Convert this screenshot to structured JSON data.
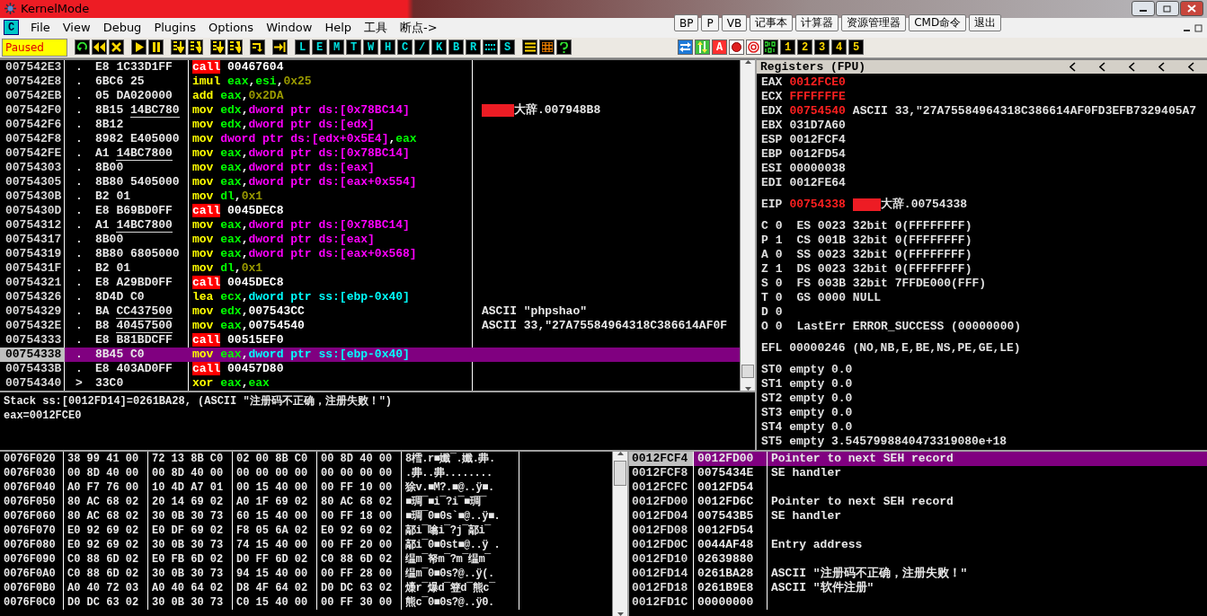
{
  "window": {
    "title": "KernelMode"
  },
  "menu": {
    "child_icon": "C",
    "items": [
      "File",
      "View",
      "Debug",
      "Plugins",
      "Options",
      "Window",
      "Help",
      "工具",
      "断点->"
    ]
  },
  "quick_buttons": [
    "BP",
    "P",
    "VB",
    "记事本",
    "计算器",
    "资源管理器",
    "CMD命令",
    "退出"
  ],
  "toolbar": {
    "status": "Paused",
    "groups": [
      [
        {
          "kind": "restart"
        },
        {
          "kind": "rewind"
        },
        {
          "kind": "close"
        }
      ],
      [
        {
          "kind": "play"
        },
        {
          "kind": "pause"
        }
      ],
      [
        {
          "kind": "step-into"
        },
        {
          "kind": "step-over"
        }
      ],
      [
        {
          "kind": "trace-into"
        },
        {
          "kind": "trace-over"
        }
      ],
      [
        {
          "kind": "return"
        }
      ],
      [
        {
          "kind": "goto"
        }
      ],
      [
        {
          "kind": "letter",
          "text": "L"
        },
        {
          "kind": "letter",
          "text": "E"
        },
        {
          "kind": "letter",
          "text": "M"
        },
        {
          "kind": "letter",
          "text": "T"
        },
        {
          "kind": "letter",
          "text": "W"
        },
        {
          "kind": "letter",
          "text": "H"
        },
        {
          "kind": "letter",
          "text": "C"
        },
        {
          "kind": "letter",
          "text": "/"
        },
        {
          "kind": "letter",
          "text": "K"
        },
        {
          "kind": "letter",
          "text": "B"
        },
        {
          "kind": "letter",
          "text": "R"
        },
        {
          "kind": "dots"
        },
        {
          "kind": "letter",
          "text": "S"
        }
      ],
      [
        {
          "kind": "list"
        },
        {
          "kind": "grid"
        },
        {
          "kind": "help"
        }
      ]
    ],
    "right_group": [
      {
        "kind": "swap"
      },
      {
        "kind": "updown"
      },
      {
        "kind": "badge",
        "text": "A"
      },
      {
        "kind": "record"
      },
      {
        "kind": "target"
      },
      {
        "kind": "binary"
      },
      {
        "kind": "digit",
        "text": "1"
      },
      {
        "kind": "digit",
        "text": "2"
      },
      {
        "kind": "digit",
        "text": "3"
      },
      {
        "kind": "digit",
        "text": "4"
      },
      {
        "kind": "digit",
        "text": "5"
      }
    ]
  },
  "disasm": {
    "rows": [
      {
        "addr": "007542E3",
        "mark": ".",
        "hex": "E8",
        "arg": "1C33D1FF",
        "ul": false,
        "mnemonic": "call",
        "kind": "call",
        "ops": [
          {
            "text": "00467604",
            "kind": "addr"
          }
        ],
        "selected": false
      },
      {
        "addr": "007542E8",
        "mark": ".",
        "hex": "6BC6",
        "arg": "25",
        "ul": false,
        "mnemonic": "imul",
        "kind": "op",
        "ops": [
          {
            "text": "eax",
            "kind": "reg"
          },
          {
            "text": ",",
            "kind": "punct"
          },
          {
            "text": "esi",
            "kind": "reg"
          },
          {
            "text": ",",
            "kind": "punct"
          },
          {
            "text": "0x25",
            "kind": "imm"
          }
        ],
        "selected": false
      },
      {
        "addr": "007542EB",
        "mark": ".",
        "hex": "05",
        "arg": "DA020000",
        "ul": false,
        "mnemonic": "add",
        "kind": "op",
        "ops": [
          {
            "text": "eax",
            "kind": "reg"
          },
          {
            "text": ",",
            "kind": "punct"
          },
          {
            "text": "0x2DA",
            "kind": "imm"
          }
        ],
        "selected": false
      },
      {
        "addr": "007542F0",
        "mark": ".",
        "hex": "8B15",
        "arg": "14BC780",
        "ul": true,
        "mnemonic": "mov",
        "kind": "op",
        "ops": [
          {
            "text": "edx",
            "kind": "reg"
          },
          {
            "text": ",",
            "kind": "punct"
          },
          {
            "text": "dword ptr ds:[0x78BC14]",
            "kind": "mem"
          }
        ],
        "comment": "大辞.007948B8",
        "redacted": true,
        "selected": false
      },
      {
        "addr": "007542F6",
        "mark": ".",
        "hex": "8B12",
        "mnemonic": "mov",
        "kind": "op",
        "ops": [
          {
            "text": "edx",
            "kind": "reg"
          },
          {
            "text": ",",
            "kind": "punct"
          },
          {
            "text": "dword ptr ds:[edx]",
            "kind": "mem"
          }
        ],
        "selected": false
      },
      {
        "addr": "007542F8",
        "mark": ".",
        "hex": "8982",
        "arg": "E405000",
        "ul": false,
        "mnemonic": "mov",
        "kind": "op",
        "ops": [
          {
            "text": "dword ptr ds:[edx+0x5E4]",
            "kind": "mem"
          },
          {
            "text": ",",
            "kind": "punct"
          },
          {
            "text": "eax",
            "kind": "reg"
          }
        ],
        "selected": false
      },
      {
        "addr": "007542FE",
        "mark": ".",
        "hex": "A1",
        "arg": "14BC7800",
        "ul": true,
        "mnemonic": "mov",
        "kind": "op",
        "ops": [
          {
            "text": "eax",
            "kind": "reg"
          },
          {
            "text": ",",
            "kind": "punct"
          },
          {
            "text": "dword ptr ds:[0x78BC14]",
            "kind": "mem"
          }
        ],
        "selected": false
      },
      {
        "addr": "00754303",
        "mark": ".",
        "hex": "8B00",
        "mnemonic": "mov",
        "kind": "op",
        "ops": [
          {
            "text": "eax",
            "kind": "reg"
          },
          {
            "text": ",",
            "kind": "punct"
          },
          {
            "text": "dword ptr ds:[eax]",
            "kind": "mem"
          }
        ],
        "selected": false
      },
      {
        "addr": "00754305",
        "mark": ".",
        "hex": "8B80",
        "arg": "5405000",
        "ul": false,
        "mnemonic": "mov",
        "kind": "op",
        "ops": [
          {
            "text": "eax",
            "kind": "reg"
          },
          {
            "text": ",",
            "kind": "punct"
          },
          {
            "text": "dword ptr ds:[eax+0x554]",
            "kind": "mem"
          }
        ],
        "selected": false
      },
      {
        "addr": "0075430B",
        "mark": ".",
        "hex": "B2",
        "arg": "01",
        "ul": false,
        "mnemonic": "mov",
        "kind": "op",
        "ops": [
          {
            "text": "dl",
            "kind": "reg"
          },
          {
            "text": ",",
            "kind": "punct"
          },
          {
            "text": "0x1",
            "kind": "imm"
          }
        ],
        "selected": false
      },
      {
        "addr": "0075430D",
        "mark": ".",
        "hex": "E8",
        "arg": "B69BD0FF",
        "ul": false,
        "mnemonic": "call",
        "kind": "call",
        "ops": [
          {
            "text": "0045DEC8",
            "kind": "addr"
          }
        ],
        "selected": false
      },
      {
        "addr": "00754312",
        "mark": ".",
        "hex": "A1",
        "arg": "14BC7800",
        "ul": true,
        "mnemonic": "mov",
        "kind": "op",
        "ops": [
          {
            "text": "eax",
            "kind": "reg"
          },
          {
            "text": ",",
            "kind": "punct"
          },
          {
            "text": "dword ptr ds:[0x78BC14]",
            "kind": "mem"
          }
        ],
        "selected": false
      },
      {
        "addr": "00754317",
        "mark": ".",
        "hex": "8B00",
        "mnemonic": "mov",
        "kind": "op",
        "ops": [
          {
            "text": "eax",
            "kind": "reg"
          },
          {
            "text": ",",
            "kind": "punct"
          },
          {
            "text": "dword ptr ds:[eax]",
            "kind": "mem"
          }
        ],
        "selected": false
      },
      {
        "addr": "00754319",
        "mark": ".",
        "hex": "8B80",
        "arg": "6805000",
        "ul": false,
        "mnemonic": "mov",
        "kind": "op",
        "ops": [
          {
            "text": "eax",
            "kind": "reg"
          },
          {
            "text": ",",
            "kind": "punct"
          },
          {
            "text": "dword ptr ds:[eax+0x568]",
            "kind": "mem"
          }
        ],
        "selected": false
      },
      {
        "addr": "0075431F",
        "mark": ".",
        "hex": "B2",
        "arg": "01",
        "ul": false,
        "mnemonic": "mov",
        "kind": "op",
        "ops": [
          {
            "text": "dl",
            "kind": "reg"
          },
          {
            "text": ",",
            "kind": "punct"
          },
          {
            "text": "0x1",
            "kind": "imm"
          }
        ],
        "selected": false
      },
      {
        "addr": "00754321",
        "mark": ".",
        "hex": "E8",
        "arg": "A29BD0FF",
        "ul": false,
        "mnemonic": "call",
        "kind": "call",
        "ops": [
          {
            "text": "0045DEC8",
            "kind": "addr"
          }
        ],
        "selected": false
      },
      {
        "addr": "00754326",
        "mark": ".",
        "hex": "8D4D",
        "arg": "C0",
        "ul": false,
        "mnemonic": "lea",
        "kind": "op",
        "ops": [
          {
            "text": "ecx",
            "kind": "reg"
          },
          {
            "text": ",",
            "kind": "punct"
          },
          {
            "text": "dword ptr ss:[ebp-0x40]",
            "kind": "stack"
          }
        ],
        "selected": false
      },
      {
        "addr": "00754329",
        "mark": ".",
        "hex": "BA",
        "arg": "CC437500",
        "ul": true,
        "mnemonic": "mov",
        "kind": "op",
        "ops": [
          {
            "text": "edx",
            "kind": "reg"
          },
          {
            "text": ",",
            "kind": "punct"
          },
          {
            "text": "007543CC",
            "kind": "addr"
          }
        ],
        "comment": "ASCII \"phpshao\"",
        "selected": false
      },
      {
        "addr": "0075432E",
        "mark": ".",
        "hex": "B8",
        "arg": "40457500",
        "ul": true,
        "mnemonic": "mov",
        "kind": "op",
        "ops": [
          {
            "text": "eax",
            "kind": "reg"
          },
          {
            "text": ",",
            "kind": "punct"
          },
          {
            "text": "00754540",
            "kind": "addr"
          }
        ],
        "comment": "ASCII 33,\"27A75584964318C386614AF0F",
        "selected": false
      },
      {
        "addr": "00754333",
        "mark": ".",
        "hex": "E8",
        "arg": "B81BDCFF",
        "ul": false,
        "mnemonic": "call",
        "kind": "call",
        "ops": [
          {
            "text": "00515EF0",
            "kind": "addr"
          }
        ],
        "selected": false
      },
      {
        "addr": "00754338",
        "mark": ".",
        "hex": "8B45",
        "arg": "C0",
        "ul": false,
        "mnemonic": "mov",
        "kind": "op",
        "ops": [
          {
            "text": "eax",
            "kind": "reg"
          },
          {
            "text": ",",
            "kind": "punct"
          },
          {
            "text": "dword ptr ss:[ebp-0x40]",
            "kind": "stack"
          }
        ],
        "selected": true
      },
      {
        "addr": "0075433B",
        "mark": ".",
        "hex": "E8",
        "arg": "403AD0FF",
        "ul": false,
        "mnemonic": "call",
        "kind": "call",
        "ops": [
          {
            "text": "00457D80",
            "kind": "addr"
          }
        ],
        "selected": false
      },
      {
        "addr": "00754340",
        "mark": ">",
        "hex": "33C0",
        "mnemonic": "xor",
        "kind": "op",
        "ops": [
          {
            "text": "eax",
            "kind": "reg"
          },
          {
            "text": ",",
            "kind": "punct"
          },
          {
            "text": "eax",
            "kind": "reg"
          }
        ],
        "selected": false
      }
    ]
  },
  "info": [
    "Stack ss:[0012FD14]=0261BA28, (ASCII \"注册码不正确，注册失败！\")",
    "eax=0012FCE0"
  ],
  "registers": {
    "title": "Registers (FPU)",
    "general": [
      {
        "name": "EAX",
        "value": "0012FCE0",
        "changed": true
      },
      {
        "name": "ECX",
        "value": "FFFFFFFE",
        "changed": true
      },
      {
        "name": "EDX",
        "value": "00754540",
        "changed": true,
        "comment": "ASCII 33,\"27A75584964318C386614AF0FD3EFB7329405A7"
      },
      {
        "name": "EBX",
        "value": "031D7A60",
        "changed": false
      },
      {
        "name": "ESP",
        "value": "0012FCF4",
        "changed": false
      },
      {
        "name": "EBP",
        "value": "0012FD54",
        "changed": false
      },
      {
        "name": "ESI",
        "value": "00000038",
        "changed": false
      },
      {
        "name": "EDI",
        "value": "0012FE64",
        "changed": false
      }
    ],
    "eip": {
      "name": "EIP",
      "value": "00754338",
      "changed": true,
      "redacted": true,
      "comment": "大辞.00754338"
    },
    "flags": [
      {
        "flag": "C",
        "value": "0",
        "seg": "ES 0023 32bit 0(FFFFFFFF)"
      },
      {
        "flag": "P",
        "value": "1",
        "seg": "CS 001B 32bit 0(FFFFFFFF)"
      },
      {
        "flag": "A",
        "value": "0",
        "seg": "SS 0023 32bit 0(FFFFFFFF)"
      },
      {
        "flag": "Z",
        "value": "1",
        "seg": "DS 0023 32bit 0(FFFFFFFF)"
      },
      {
        "flag": "S",
        "value": "0",
        "seg": "FS 003B 32bit 7FFDE000(FFF)"
      },
      {
        "flag": "T",
        "value": "0",
        "seg": "GS 0000 NULL"
      },
      {
        "flag": "D",
        "value": "0"
      },
      {
        "flag": "O",
        "value": "0",
        "seg": "LastErr ERROR_SUCCESS (00000000)"
      }
    ],
    "efl": "EFL 00000246 (NO,NB,E,BE,NS,PE,GE,LE)",
    "fpu": [
      "ST0 empty 0.0",
      "ST1 empty 0.0",
      "ST2 empty 0.0",
      "ST3 empty 0.0",
      "ST4 empty 0.0",
      "ST5 empty 3.5457998840473319080e+18"
    ]
  },
  "dump": {
    "rows": [
      {
        "addr": "0076F020",
        "bytes": [
          "38 99 41 00",
          "72 13 8B C0",
          "02 00 8B C0",
          "00 8D 40 00"
        ],
        "ascii": "8樰.r■孅¯.孅.丳."
      },
      {
        "addr": "0076F030",
        "bytes": [
          "00 8D 40 00",
          "00 8D 40 00",
          "00 00 00 00",
          "00 00 00 00"
        ],
        "ascii": ".丳..丳........"
      },
      {
        "addr": "0076F040",
        "bytes": [
          "A0 F7 76 00",
          "10 4D A7 01",
          "00 15 40 00",
          "00 FF 10 00"
        ],
        "ascii": "狳v.■M?.■@..ÿ■."
      },
      {
        "addr": "0076F050",
        "bytes": [
          "80 AC 68 02",
          "20 14 69 02",
          "A0 1F 69 02",
          "80 AC 68 02"
        ],
        "ascii": "■琱¯■i¯?i¯■琱¯"
      },
      {
        "addr": "0076F060",
        "bytes": [
          "80 AC 68 02",
          "30 0B 30 73",
          "60 15 40 00",
          "00 FF 18 00"
        ],
        "ascii": "■琱¯0■0s`■@..ÿ■."
      },
      {
        "addr": "0076F070",
        "bytes": [
          "E0 92 69 02",
          "E0 DF 69 02",
          "F8 05 6A 02",
          "E0 92 69 02"
        ],
        "ascii": "鄗i¯噏i¯?j¯鄗i¯"
      },
      {
        "addr": "0076F080",
        "bytes": [
          "E0 92 69 02",
          "30 0B 30 73",
          "74 15 40 00",
          "00 FF 20 00"
        ],
        "ascii": "鄗i¯0■0st■@..ÿ ."
      },
      {
        "addr": "0076F090",
        "bytes": [
          "C0 88 6D 02",
          "E0 FB 6D 02",
          "D0 FF 6D 02",
          "C0 88 6D 02"
        ],
        "ascii": "缊m¯帑m¯?m¯缊m¯"
      },
      {
        "addr": "0076F0A0",
        "bytes": [
          "C0 88 6D 02",
          "30 0B 30 73",
          "94 15 40 00",
          "00 FF 28 00"
        ],
        "ascii": "缊m¯0■0s?@..ÿ(."
      },
      {
        "addr": "0076F0B0",
        "bytes": [
          "A0 40 72 03",
          "A0 40 64 02",
          "D8 4F 64 02",
          "D0 DC 63 02"
        ],
        "ascii": "燺r¯爆d¯簦d¯熊c¯"
      },
      {
        "addr": "0076F0C0",
        "bytes": [
          "D0 DC 63 02",
          "30 0B 30 73",
          "C0 15 40 00",
          "00 FF 30 00"
        ],
        "ascii": "熊c¯0■0s?@..ÿ0."
      }
    ]
  },
  "stack": {
    "rows": [
      {
        "addr": "0012FCF4",
        "value": "0012FD00",
        "comment": "Pointer to next SEH record",
        "selected": true
      },
      {
        "addr": "0012FCF8",
        "value": "0075434E",
        "comment": "SE handler",
        "selected": false
      },
      {
        "addr": "0012FCFC",
        "value": "0012FD54",
        "selected": false
      },
      {
        "addr": "0012FD00",
        "value": "0012FD6C",
        "comment": "Pointer to next SEH record",
        "selected": false
      },
      {
        "addr": "0012FD04",
        "value": "007543B5",
        "comment": "SE handler",
        "selected": false
      },
      {
        "addr": "0012FD08",
        "value": "0012FD54",
        "selected": false
      },
      {
        "addr": "0012FD0C",
        "value": "0044AF48",
        "comment": "Entry address",
        "selected": false
      },
      {
        "addr": "0012FD10",
        "value": "02639880",
        "selected": false
      },
      {
        "addr": "0012FD14",
        "value": "0261BA28",
        "comment": "ASCII \"注册码不正确，注册失败！\"",
        "selected": false
      },
      {
        "addr": "0012FD18",
        "value": "0261B9E8",
        "comment": "ASCII \"软件注册\"",
        "selected": false
      },
      {
        "addr": "0012FD1C",
        "value": "00000000",
        "selected": false
      }
    ]
  }
}
